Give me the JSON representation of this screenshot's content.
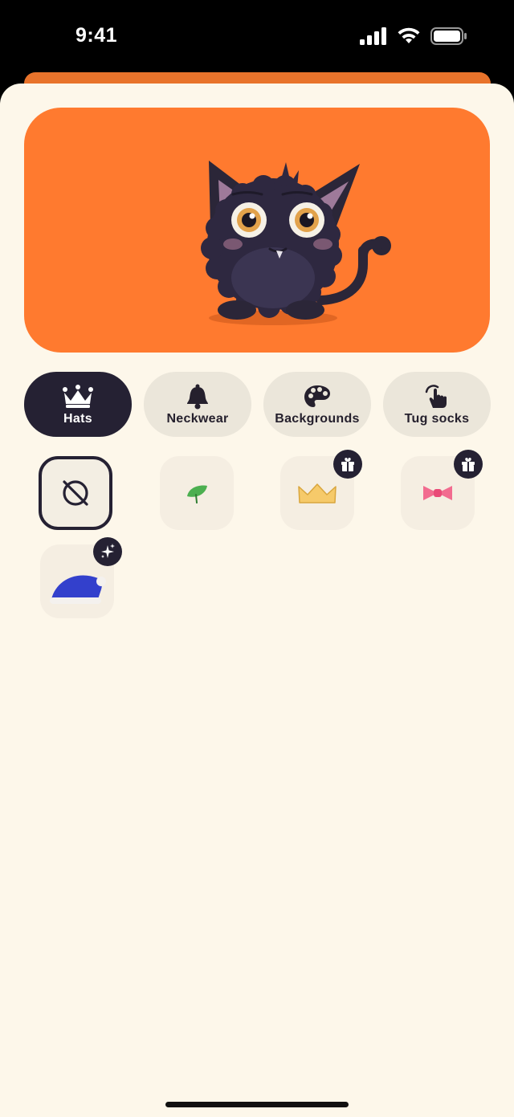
{
  "status": {
    "time": "9:41"
  },
  "tabs": [
    {
      "label": "Hats",
      "icon": "crown-icon",
      "active": true
    },
    {
      "label": "Neckwear",
      "icon": "bell-icon",
      "active": false
    },
    {
      "label": "Backgrounds",
      "icon": "palette-icon",
      "active": false
    },
    {
      "label": "Tug socks",
      "icon": "hand-pointer-icon",
      "active": false
    }
  ],
  "items": [
    {
      "name": "no-hat",
      "icon": "no-item-icon",
      "selected": true,
      "badge": null
    },
    {
      "name": "leaf",
      "icon": "leaf-icon",
      "selected": false,
      "badge": null
    },
    {
      "name": "crown",
      "icon": "crown-hat-icon",
      "selected": false,
      "badge": "gift-icon"
    },
    {
      "name": "bow",
      "icon": "bow-icon",
      "selected": false,
      "badge": "gift-icon"
    },
    {
      "name": "santa-hat",
      "icon": "santa-hat-icon",
      "selected": false,
      "badge": "sparkles-icon"
    }
  ],
  "colors": {
    "accent": "#FF7A2F",
    "dark": "#252133",
    "sheet": "#FDF7EA",
    "tab_inactive": "#EBE6DA",
    "item_tile": "#F5EEE2"
  }
}
